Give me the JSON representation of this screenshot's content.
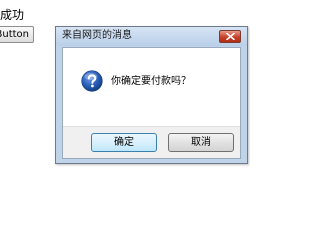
{
  "background": {
    "status_text": "款成功",
    "button_label": "Button"
  },
  "dialog": {
    "title": "来自网页的消息",
    "message": "你确定要付款吗？",
    "icon": "question-icon",
    "ok_label": "确定",
    "cancel_label": "取消",
    "colors": {
      "title_bar": "#c9dbef",
      "close_button": "#c7402a",
      "icon_blue": "#2a5fb8"
    }
  }
}
